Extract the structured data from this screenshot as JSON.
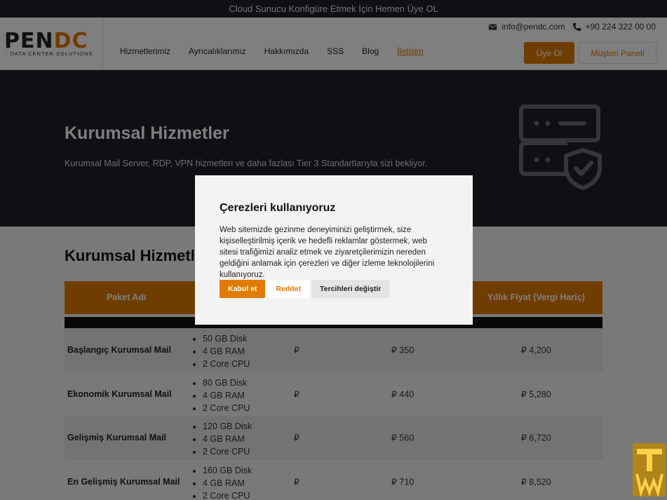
{
  "topbar": {
    "text": "Cloud Sunucu Konfigüre Etmek İçin Hemen Üye OL"
  },
  "logo": {
    "main_pen": "PEN",
    "main_dc": "DC",
    "sub": "· DATA CENTER SOLUTIONS ·"
  },
  "contact": {
    "email": "info@pendc.com",
    "phone": "+90 224 322 00 00"
  },
  "nav": {
    "items": [
      "Hizmetlerimiz",
      "Ayrıcalıklarımız",
      "Hakkımızda",
      "SSS",
      "Blog",
      "İletişim"
    ],
    "active": "İletişim"
  },
  "header_buttons": {
    "register": "Üye Ol",
    "client_panel": "Müşteri Paneli"
  },
  "hero": {
    "title": "Kurumsal Hizmetler",
    "subtitle": "Kurumsal Mail Server, RDP, VPN hizmetleri ve daha fazlası Tier 3 Standartlarıyla sizi bekliyor."
  },
  "section": {
    "title": "Kurumsal Hizmetler"
  },
  "table": {
    "headers": [
      "Paket Adı",
      "Yıllık Fiyat (Vergi Hariç)"
    ],
    "rows": [
      {
        "name": "Başlangıç Kurumsal Mail",
        "features": [
          "50 GB Disk",
          "4 GB RAM",
          "2 Core CPU"
        ],
        "col3": "₽",
        "col4": "₽ 350",
        "col5": "₽ 4,200"
      },
      {
        "name": "Ekonomik Kurumsal Mail",
        "features": [
          "80 GB Disk",
          "4 GB RAM",
          "2 Core CPU"
        ],
        "col3": "₽",
        "col4": "₽ 440",
        "col5": "₽ 5,280"
      },
      {
        "name": "Gelişmiş Kurumsal Mail",
        "features": [
          "120 GB Disk",
          "4 GB RAM",
          "2 Core CPU"
        ],
        "col3": "₽",
        "col4": "₽ 560",
        "col5": "₽ 6,720"
      },
      {
        "name": "En Gelişmiş Kurumsal Mail",
        "features": [
          "160 GB Disk",
          "4 GB RAM",
          "2 Core CPU"
        ],
        "col3": "₽",
        "col4": "₽ 710",
        "col5": "₽ 8,520"
      }
    ]
  },
  "cookie_modal": {
    "title": "Çerezleri kullanıyoruz",
    "body": "Web sitemizde gezinme deneyiminizi geliştirmek, size kişiselleştirilmiş içerik ve hedefli reklamlar göstermek, web sitesi trafiğimizi analiz etmek ve ziyaretçilerimizin nereden geldiğini anlamak için çerezleri ve diğer izleme teknolojilerini kullanıyoruz.",
    "accept": "Kabul et",
    "reject": "Reddet",
    "preferences": "Tercihleri değiştir"
  },
  "colors": {
    "accent": "#e07b00",
    "dark": "#1e1e28"
  }
}
